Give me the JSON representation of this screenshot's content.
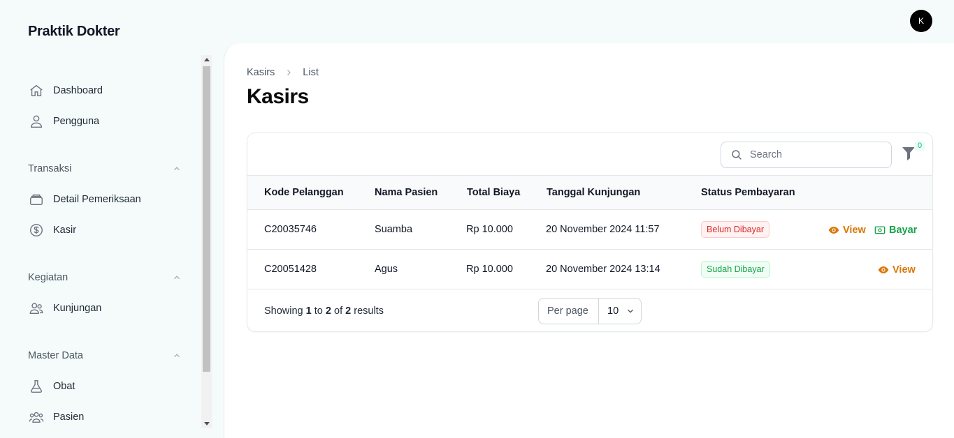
{
  "app": {
    "title": "Praktik Dokter",
    "avatar_initial": "K"
  },
  "sidebar": {
    "items_top": [
      {
        "label": "Dashboard",
        "icon": "home-icon"
      },
      {
        "label": "Pengguna",
        "icon": "user-icon"
      }
    ],
    "groups": [
      {
        "label": "Transaksi",
        "items": [
          {
            "label": "Detail Pemeriksaan",
            "icon": "stack-icon"
          },
          {
            "label": "Kasir",
            "icon": "dollar-circle-icon"
          }
        ]
      },
      {
        "label": "Kegiatan",
        "items": [
          {
            "label": "Kunjungan",
            "icon": "users-icon"
          }
        ]
      },
      {
        "label": "Master Data",
        "items": [
          {
            "label": "Obat",
            "icon": "beaker-icon"
          },
          {
            "label": "Pasien",
            "icon": "user-group-icon"
          }
        ]
      }
    ]
  },
  "breadcrumb": {
    "parent": "Kasirs",
    "current": "List"
  },
  "page": {
    "title": "Kasirs"
  },
  "table": {
    "search_placeholder": "Search",
    "filter_count": "0",
    "columns": [
      "Kode Pelanggan",
      "Nama Pasien",
      "Total Biaya",
      "Tanggal Kunjungan",
      "Status Pembayaran"
    ],
    "rows": [
      {
        "kode": "C20035746",
        "nama": "Suamba",
        "biaya": "Rp 10.000",
        "tanggal": "20 November 2024 11:57",
        "status": "Belum Dibayar",
        "status_color": "#dc2626",
        "actions": [
          "View",
          "Bayar"
        ]
      },
      {
        "kode": "C20051428",
        "nama": "Agus",
        "biaya": "Rp 10.000",
        "tanggal": "20 November 2024 13:14",
        "status": "Sudah Dibayar",
        "status_color": "#16a34a",
        "actions": [
          "View"
        ]
      }
    ],
    "footer": {
      "prefix": "Showing",
      "from": "1",
      "to_word": "to",
      "to": "2",
      "of_word": "of",
      "total": "2",
      "suffix": "results"
    },
    "per_page_label": "Per page",
    "per_page_value": "10"
  },
  "colors": {
    "accent_view": "#d97706",
    "accent_pay": "#16a34a",
    "background": "#f4fbfa"
  }
}
